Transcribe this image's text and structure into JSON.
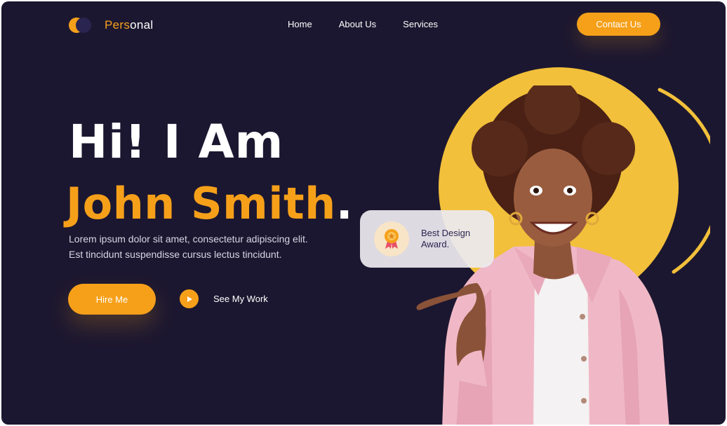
{
  "brand": {
    "name_part1": "Pers",
    "name_part2": "onal",
    "accent_color": "#f6a01a",
    "background_color": "#1c1730"
  },
  "nav": {
    "items": [
      {
        "label": "Home"
      },
      {
        "label": "About Us"
      },
      {
        "label": "Services"
      }
    ],
    "contact_label": "Contact Us"
  },
  "hero": {
    "greeting": "Hi! I Am",
    "name": "John Smith",
    "name_dot": ".",
    "description_line1": "Lorem ipsum dolor sit amet, consectetur adipiscing elit.",
    "description_line2": "Est tincidunt suspendisse cursus lectus tincidunt.",
    "hire_label": "Hire Me",
    "see_work_label": "See My Work",
    "play_icon": "play-icon"
  },
  "award": {
    "line1": "Best Design",
    "line2": "Award.",
    "icon": "medal-icon"
  }
}
